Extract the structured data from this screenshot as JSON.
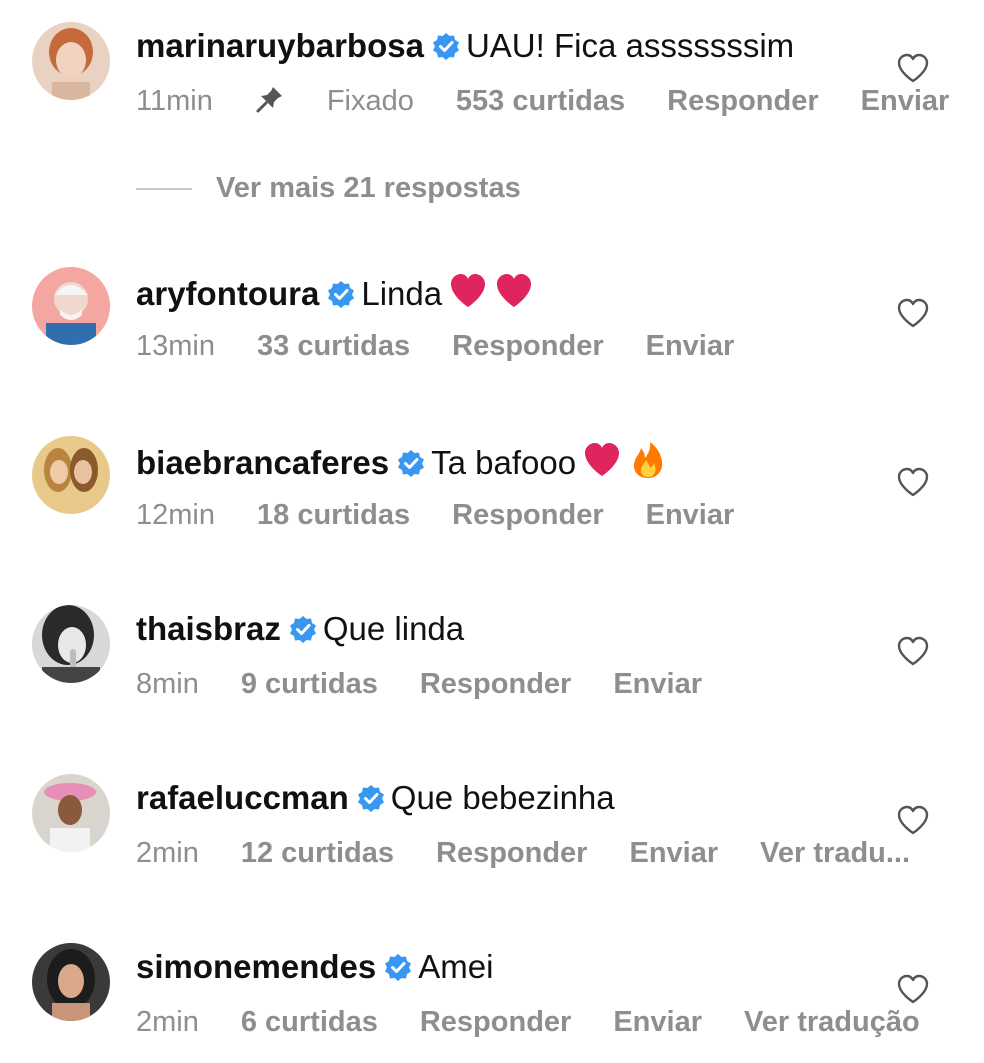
{
  "comments": [
    {
      "username": "marinaruybarbosa",
      "text": "UAU! Fica asssssssim",
      "emojis": [],
      "time": "11min",
      "pinned": "Fixado",
      "likes": "553 curtidas",
      "reply": "Responder",
      "send": "Enviar",
      "translate": ""
    },
    {
      "username": "aryfontoura",
      "text": "Linda",
      "emojis": [
        "red-heart",
        "red-heart"
      ],
      "time": "13min",
      "pinned": "",
      "likes": "33 curtidas",
      "reply": "Responder",
      "send": "Enviar",
      "translate": ""
    },
    {
      "username": "biaebrancaferes",
      "text": "Ta bafooo",
      "emojis": [
        "red-heart",
        "fire"
      ],
      "time": "12min",
      "pinned": "",
      "likes": "18 curtidas",
      "reply": "Responder",
      "send": "Enviar",
      "translate": ""
    },
    {
      "username": "thaisbraz",
      "text": "Que linda",
      "emojis": [],
      "time": "8min",
      "pinned": "",
      "likes": "9 curtidas",
      "reply": "Responder",
      "send": "Enviar",
      "translate": ""
    },
    {
      "username": "rafaeluccman",
      "text": "Que bebezinha",
      "emojis": [],
      "time": "2min",
      "pinned": "",
      "likes": "12 curtidas",
      "reply": "Responder",
      "send": "Enviar",
      "translate": "Ver tradu..."
    },
    {
      "username": "simonemendes",
      "text": "Amei",
      "emojis": [],
      "time": "2min",
      "pinned": "",
      "likes": "6 curtidas",
      "reply": "Responder",
      "send": "Enviar",
      "translate": "Ver tradução"
    }
  ],
  "view_replies": "Ver mais 21 respostas",
  "colors": {
    "verified": "#3897f0",
    "meta": "#8e8e8e",
    "heart_emoji": "#e0245e",
    "fire": "#ff7a00"
  }
}
